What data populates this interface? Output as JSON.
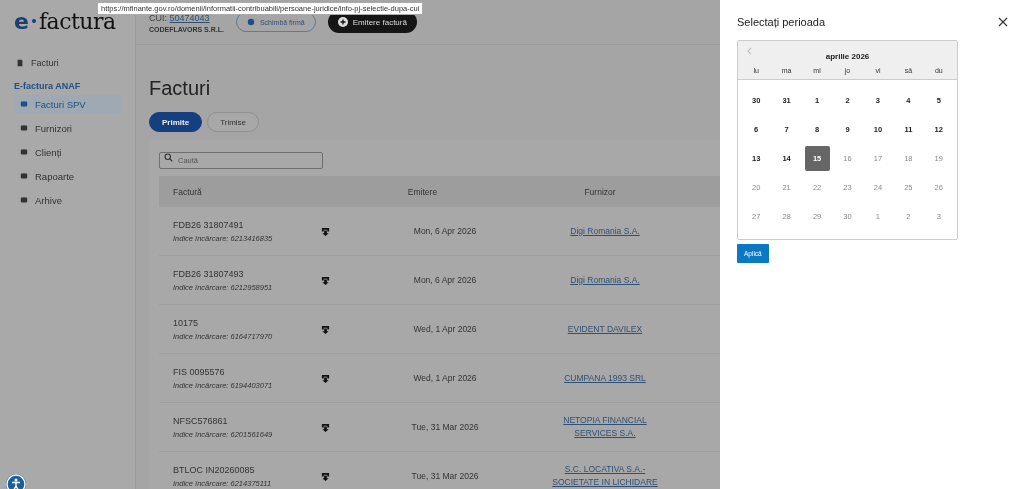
{
  "logo": {
    "prefix": "e",
    "name": "factura"
  },
  "tooltip": {
    "text": "https://mfinante.gov.ro/domenii/informatii-contribuabili/persoane-juridice/info-pj-selectie-dupa-cui"
  },
  "company": {
    "cui_label": "CUI:",
    "cui": "50474043",
    "name": "CODEFLAVORS S.R.L.",
    "change_button": "Schimbă firmă",
    "issue_button": "Emitere factură"
  },
  "sidebar": {
    "top_item": {
      "label": "Facturi"
    },
    "section": "E-factura ANAF",
    "items": [
      {
        "label": "Facturi SPV",
        "selected": true
      },
      {
        "label": "Furnizori",
        "selected": false
      },
      {
        "label": "Clienți",
        "selected": false
      },
      {
        "label": "Rapoarte",
        "selected": false
      },
      {
        "label": "Arhive",
        "selected": false
      }
    ]
  },
  "page_title": "Facturi",
  "tabs": [
    {
      "label": "Primite",
      "selected": true
    },
    {
      "label": "Trimise",
      "selected": false
    }
  ],
  "search": {
    "placeholder": "Caută"
  },
  "table": {
    "columns": [
      "Factură",
      "Emitere",
      "Furnizor"
    ],
    "rows": [
      {
        "number": "FDB26 31807491",
        "index": "Indice încărcare: 6213416835",
        "date": "Mon, 6 Apr 2026",
        "supplier": "Digi Romania S.A."
      },
      {
        "number": "FDB26 31807493",
        "index": "Indice încărcare: 6212958951",
        "date": "Mon, 6 Apr 2026",
        "supplier": "Digi Romania S.A."
      },
      {
        "number": "10175",
        "index": "Indice încărcare: 6164717970",
        "date": "Wed, 1 Apr 2026",
        "supplier": "EVIDENT DAVILEX"
      },
      {
        "number": "FIS 0095576",
        "index": "Indice încărcare: 6194403071",
        "date": "Wed, 1 Apr 2026",
        "supplier": "CUMPANA 1993 SRL"
      },
      {
        "number": "NFSC576861",
        "index": "Indice încărcare: 6201561649",
        "date": "Tue, 31 Mar 2026",
        "supplier": "NETOPIA FINANCIAL SERVICES S.A."
      },
      {
        "number": "BTLOC IN20260085",
        "index": "Indice încărcare: 6214375111",
        "date": "Tue, 31 Mar 2026",
        "supplier": "S.C. LOCATIVA S.A.- SOCIETATE IN LICHIDARE"
      }
    ]
  },
  "drawer": {
    "title": "Selectați perioada",
    "calendar": {
      "month": "aprilie 2026",
      "weekdays": [
        "lu",
        "ma",
        "mi",
        "jo",
        "vi",
        "sâ",
        "du"
      ],
      "days": [
        {
          "label": "30",
          "disabled": false,
          "selected": false
        },
        {
          "label": "31",
          "disabled": false,
          "selected": false
        },
        {
          "label": "1",
          "disabled": false,
          "selected": false
        },
        {
          "label": "2",
          "disabled": false,
          "selected": false
        },
        {
          "label": "3",
          "disabled": false,
          "selected": false
        },
        {
          "label": "4",
          "disabled": false,
          "selected": false
        },
        {
          "label": "5",
          "disabled": false,
          "selected": false
        },
        {
          "label": "6",
          "disabled": false,
          "selected": false
        },
        {
          "label": "7",
          "disabled": false,
          "selected": false
        },
        {
          "label": "8",
          "disabled": false,
          "selected": false
        },
        {
          "label": "9",
          "disabled": false,
          "selected": false
        },
        {
          "label": "10",
          "disabled": false,
          "selected": false
        },
        {
          "label": "11",
          "disabled": false,
          "selected": false
        },
        {
          "label": "12",
          "disabled": false,
          "selected": false
        },
        {
          "label": "13",
          "disabled": false,
          "selected": false
        },
        {
          "label": "14",
          "disabled": false,
          "selected": false
        },
        {
          "label": "15",
          "disabled": false,
          "selected": true
        },
        {
          "label": "16",
          "disabled": true,
          "selected": false
        },
        {
          "label": "17",
          "disabled": true,
          "selected": false
        },
        {
          "label": "18",
          "disabled": true,
          "selected": false
        },
        {
          "label": "19",
          "disabled": true,
          "selected": false
        },
        {
          "label": "20",
          "disabled": true,
          "selected": false
        },
        {
          "label": "21",
          "disabled": true,
          "selected": false
        },
        {
          "label": "22",
          "disabled": true,
          "selected": false
        },
        {
          "label": "23",
          "disabled": true,
          "selected": false
        },
        {
          "label": "24",
          "disabled": true,
          "selected": false
        },
        {
          "label": "25",
          "disabled": true,
          "selected": false
        },
        {
          "label": "26",
          "disabled": true,
          "selected": false
        },
        {
          "label": "27",
          "disabled": true,
          "selected": false
        },
        {
          "label": "28",
          "disabled": true,
          "selected": false
        },
        {
          "label": "29",
          "disabled": true,
          "selected": false
        },
        {
          "label": "30",
          "disabled": true,
          "selected": false
        },
        {
          "label": "1",
          "disabled": true,
          "selected": false
        },
        {
          "label": "2",
          "disabled": true,
          "selected": false
        },
        {
          "label": "3",
          "disabled": true,
          "selected": false
        }
      ]
    },
    "apply_button": "Aplică"
  }
}
